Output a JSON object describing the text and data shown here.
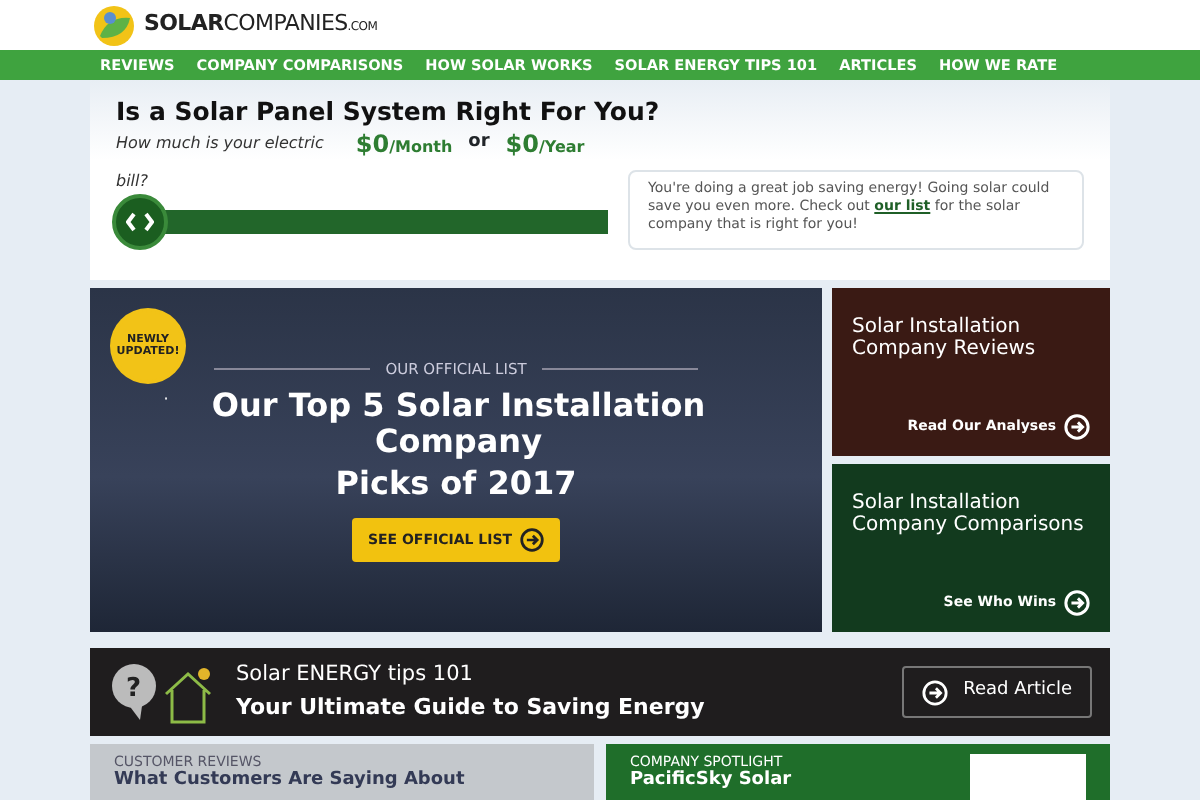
{
  "logo": {
    "brand_bold": "SOLAR",
    "brand_light": "COMPANIES",
    "brand_suffix": ".COM"
  },
  "nav": [
    "REVIEWS",
    "COMPANY COMPARISONS",
    "HOW SOLAR WORKS",
    "SOLAR ENERGY TIPS 101",
    "ARTICLES",
    "HOW WE RATE"
  ],
  "calculator": {
    "title": "Is a Solar Panel System Right For You?",
    "question_start": "How much is your electric",
    "question_end": "bill?",
    "monthly": "$0",
    "monthly_unit": "/Month",
    "or": "or",
    "yearly": "$0",
    "yearly_unit": "/Year",
    "slider": {
      "level": 0
    },
    "message_before": "You're doing a great job saving energy! Going solar could save you even more. Check out ",
    "message_link": "our list",
    "message_after": " for the solar company that is right for you!"
  },
  "hero": {
    "badge": "NEWLY UPDATED!",
    "eyebrow": "OUR OFFICIAL LIST",
    "mark": "·",
    "title_line1": "Our Top 5 Solar Installation Company",
    "title_line2": "Picks of 2017",
    "button": "SEE OFFICIAL LIST"
  },
  "tiles": [
    {
      "title": "Solar Installation Company Reviews",
      "link": "Read Our Analyses",
      "color": "#3a1a14"
    },
    {
      "title": "Solar Installation Company Comparisons",
      "link": "See Who Wins",
      "color": "#123a1e"
    }
  ],
  "tips_banner": {
    "icon_char": "?",
    "eyebrow": "Solar ENERGY tips 101",
    "title": "Your Ultimate Guide to Saving Energy",
    "button": "Read Article"
  },
  "bottom": [
    {
      "eyebrow": "CUSTOMER REVIEWS",
      "title": "What Customers Are Saying About",
      "color": "#c4c8cc"
    },
    {
      "eyebrow": "COMPANY SPOTLIGHT",
      "title": "PacificSky Solar",
      "color": "#1f6e2a"
    }
  ]
}
